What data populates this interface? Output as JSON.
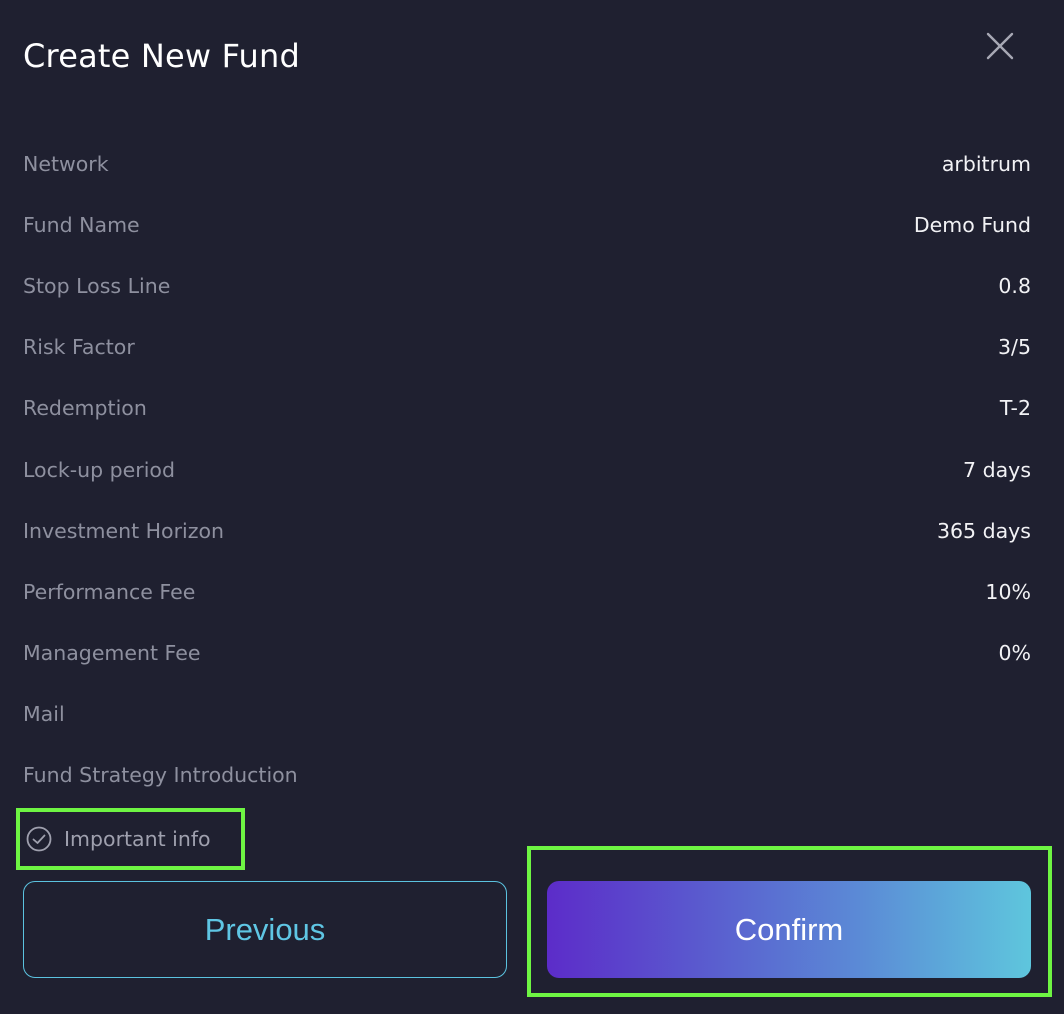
{
  "modal": {
    "title": "Create New Fund",
    "close_icon": "close-icon"
  },
  "details": [
    {
      "label": "Network",
      "value": "arbitrum"
    },
    {
      "label": "Fund Name",
      "value": "Demo Fund"
    },
    {
      "label": "Stop Loss Line",
      "value": "0.8"
    },
    {
      "label": "Risk Factor",
      "value": "3/5"
    },
    {
      "label": "Redemption",
      "value": "T-2"
    },
    {
      "label": "Lock-up period",
      "value": "7 days"
    },
    {
      "label": "Investment Horizon",
      "value": "365 days"
    },
    {
      "label": "Performance Fee",
      "value": "10%"
    },
    {
      "label": "Management Fee",
      "value": "0%"
    },
    {
      "label": "Mail",
      "value": ""
    },
    {
      "label": "Fund Strategy Introduction",
      "value": ""
    }
  ],
  "important_info": {
    "label": "Important info",
    "icon": "check-circle-icon"
  },
  "actions": {
    "previous_label": "Previous",
    "confirm_label": "Confirm"
  },
  "colors": {
    "background": "#1f2030",
    "label_text": "#8e909f",
    "value_text": "#f2f2f5",
    "accent_cyan": "#5bc2df",
    "gradient_start": "#5c2cc9",
    "gradient_end": "#5ec6dd",
    "highlight_outline": "#6ef543"
  }
}
